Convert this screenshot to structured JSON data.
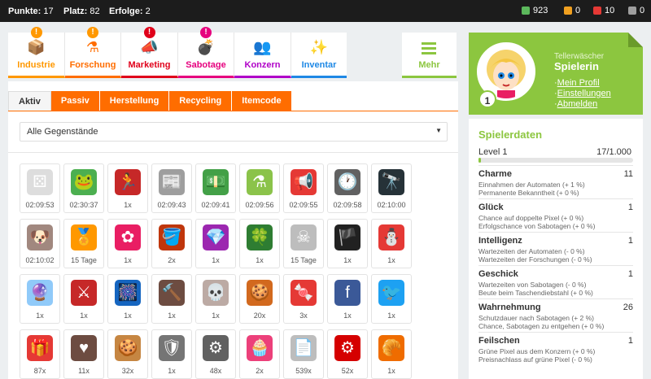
{
  "topbar": {
    "punkte_label": "Punkte:",
    "punkte_value": "17",
    "platz_label": "Platz:",
    "platz_value": "82",
    "erfolge_label": "Erfolge:",
    "erfolge_value": "2",
    "resources": [
      {
        "icon": "green-cube-icon",
        "color": "#5cb85c",
        "value": "923"
      },
      {
        "icon": "orange-cube-icon",
        "color": "#f0a020",
        "value": "0"
      },
      {
        "icon": "red-cube-icon",
        "color": "#e53935",
        "value": "10"
      },
      {
        "icon": "gray-cube-icon",
        "color": "#9e9e9e",
        "value": "0"
      }
    ]
  },
  "categories": [
    {
      "label": "Industrie",
      "color": "#ff9800",
      "icon": "box-icon",
      "glyph": "📦",
      "badge": "!",
      "badge_color": "#ff9800"
    },
    {
      "label": "Forschung",
      "color": "#ff6d00",
      "icon": "flask-icon",
      "glyph": "⚗",
      "badge": "!",
      "badge_color": "#ff9800"
    },
    {
      "label": "Marketing",
      "color": "#e0001a",
      "icon": "megaphone-icon",
      "glyph": "📣",
      "badge": "!",
      "badge_color": "#e0001a"
    },
    {
      "label": "Sabotage",
      "color": "#e6007e",
      "icon": "bomb-icon",
      "glyph": "💣",
      "badge": "!",
      "badge_color": "#e6007e"
    },
    {
      "label": "Konzern",
      "color": "#b000c8",
      "icon": "people-icon",
      "glyph": "👥",
      "badge": "",
      "badge_color": ""
    },
    {
      "label": "Inventar",
      "color": "#1e88e5",
      "icon": "wand-icon",
      "glyph": "✨",
      "badge": "",
      "badge_color": ""
    }
  ],
  "mehr": {
    "label": "Mehr",
    "color": "#8cc63f"
  },
  "subtabs": [
    "Aktiv",
    "Passiv",
    "Herstellung",
    "Recycling",
    "Itemcode"
  ],
  "select": {
    "value": "Alle Gegenstände"
  },
  "items": [
    {
      "icon": "dice-icon",
      "glyph": "⚄",
      "bg": "#dddddd",
      "count": "02:09:53"
    },
    {
      "icon": "frog-icon",
      "glyph": "🐸",
      "bg": "#4caf50",
      "count": "02:30:37"
    },
    {
      "icon": "runner-icon",
      "glyph": "🏃",
      "bg": "#c62828",
      "count": "1x"
    },
    {
      "icon": "newspaper-icon",
      "glyph": "📰",
      "bg": "#9e9e9e",
      "count": "02:09:43"
    },
    {
      "icon": "money-icon",
      "glyph": "💵",
      "bg": "#43a047",
      "count": "02:09:41"
    },
    {
      "icon": "potion-icon",
      "glyph": "⚗",
      "bg": "#8bc34a",
      "count": "02:09:56"
    },
    {
      "icon": "megaphone-icon",
      "glyph": "📢",
      "bg": "#e53935",
      "count": "02:09:55"
    },
    {
      "icon": "clock-icon",
      "glyph": "🕐",
      "bg": "#616161",
      "count": "02:09:58"
    },
    {
      "icon": "binoculars-icon",
      "glyph": "🔭",
      "bg": "#263238",
      "count": "02:10:00"
    },
    {
      "icon": "dog-icon",
      "glyph": "🐶",
      "bg": "#a1887f",
      "count": "02:10:02"
    },
    {
      "icon": "medal-icon",
      "glyph": "🏅",
      "bg": "#ff9800",
      "count": "15 Tage"
    },
    {
      "icon": "gear-flower-icon",
      "glyph": "✿",
      "bg": "#e91e63",
      "count": "1x"
    },
    {
      "icon": "paint-bucket-icon",
      "glyph": "🪣",
      "bg": "#bf360c",
      "count": "2x"
    },
    {
      "icon": "diamond-icon",
      "glyph": "💎",
      "bg": "#9c27b0",
      "count": "1x"
    },
    {
      "icon": "clover-icon",
      "glyph": "🍀",
      "bg": "#2e7d32",
      "count": "1x"
    },
    {
      "icon": "bone-icon",
      "glyph": "☠",
      "bg": "#bdbdbd",
      "count": "15 Tage"
    },
    {
      "icon": "pirate-flag-icon",
      "glyph": "🏴",
      "bg": "#212121",
      "count": "1x"
    },
    {
      "icon": "snowman-icon",
      "glyph": "⛄",
      "bg": "#e53935",
      "count": "1x"
    },
    {
      "icon": "snowglobe-icon",
      "glyph": "🔮",
      "bg": "#90caf9",
      "count": "1x"
    },
    {
      "icon": "crossed-swords-icon",
      "glyph": "⚔",
      "bg": "#c62828",
      "count": "1x"
    },
    {
      "icon": "firework-icon",
      "glyph": "🎆",
      "bg": "#1565c0",
      "count": "1x"
    },
    {
      "icon": "hammer-icon",
      "glyph": "🔨",
      "bg": "#6d4c41",
      "count": "1x"
    },
    {
      "icon": "skull-icon",
      "glyph": "💀",
      "bg": "#bcaaa4",
      "count": "1x"
    },
    {
      "icon": "gingerbread-icon",
      "glyph": "🍪",
      "bg": "#d2691e",
      "count": "20x"
    },
    {
      "icon": "candy-cane-icon",
      "glyph": "🍬",
      "bg": "#e53935",
      "count": "3x"
    },
    {
      "icon": "facebook-icon",
      "glyph": "f",
      "bg": "#3b5998",
      "count": "1x"
    },
    {
      "icon": "twitter-icon",
      "glyph": "🐦",
      "bg": "#1da1f2",
      "count": "1x"
    },
    {
      "icon": "gift-icon",
      "glyph": "🎁",
      "bg": "#e53935",
      "count": "87x"
    },
    {
      "icon": "chocolate-heart-icon",
      "glyph": "♥",
      "bg": "#6d4c41",
      "count": "11x"
    },
    {
      "icon": "cookie-icon",
      "glyph": "🍪",
      "bg": "#c68642",
      "count": "32x"
    },
    {
      "icon": "shield-icon",
      "glyph": "🛡",
      "bg": "#757575",
      "count": "1x"
    },
    {
      "icon": "cog-icon",
      "glyph": "⚙",
      "bg": "#616161",
      "count": "48x"
    },
    {
      "icon": "cupcake-icon",
      "glyph": "🧁",
      "bg": "#ec407a",
      "count": "2x"
    },
    {
      "icon": "documents-icon",
      "glyph": "📄",
      "bg": "#bdbdbd",
      "count": "539x"
    },
    {
      "icon": "red-cog-icon",
      "glyph": "⚙",
      "bg": "#d50000",
      "count": "52x"
    },
    {
      "icon": "croissant-icon",
      "glyph": "🥐",
      "bg": "#ef6c00",
      "count": "1x"
    }
  ],
  "profile": {
    "rank": "Tellerwäscher",
    "role": "Spielerin",
    "level_badge": "1",
    "links": [
      "Mein Profil",
      "Einstellungen",
      "Abmelden"
    ]
  },
  "stats": {
    "title": "Spielerdaten",
    "level_label": "Level 1",
    "level_progress": "17/1.000",
    "level_fraction": 0.017,
    "attributes": [
      {
        "name": "Charme",
        "value": "11",
        "lines": [
          "Einnahmen der Automaten (+ 1 %)",
          "Permanente Bekanntheit (+ 0 %)"
        ]
      },
      {
        "name": "Glück",
        "value": "1",
        "lines": [
          "Chance auf doppelte Pixel (+ 0 %)",
          "Erfolgschance von Sabotagen (+ 0 %)"
        ]
      },
      {
        "name": "Intelligenz",
        "value": "1",
        "lines": [
          "Wartezeiten der Automaten (- 0 %)",
          "Wartezeiten der Forschungen (- 0 %)"
        ]
      },
      {
        "name": "Geschick",
        "value": "1",
        "lines": [
          "Wartezeiten von Sabotagen (- 0 %)",
          "Beute beim Taschendiebstahl (+ 0 %)"
        ]
      },
      {
        "name": "Wahrnehmung",
        "value": "26",
        "lines": [
          "Schutzdauer nach Sabotagen (+ 2 %)",
          "Chance, Sabotagen zu entgehen (+ 0 %)"
        ]
      },
      {
        "name": "Feilschen",
        "value": "1",
        "lines": [
          "Grüne Pixel aus dem Konzern (+ 0 %)",
          "Preisnachlass auf grüne Pixel (- 0 %)"
        ]
      }
    ]
  }
}
